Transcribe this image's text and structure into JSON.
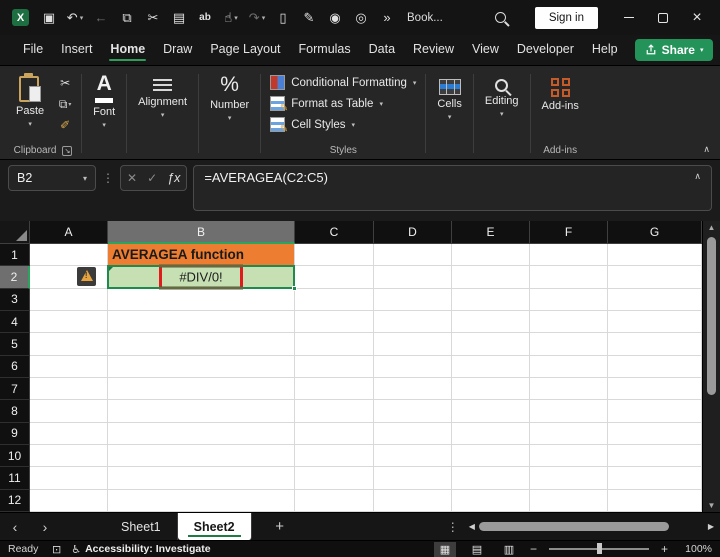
{
  "titlebar": {
    "workbook_title": "Book...",
    "signin_label": "Sign in",
    "qat": [
      {
        "name": "save-icon",
        "glyph": "▣"
      },
      {
        "name": "undo-icon",
        "glyph": "↶",
        "chevron": true
      },
      {
        "name": "back-icon",
        "glyph": "←",
        "dim": true
      },
      {
        "name": "copy-icon",
        "glyph": "⧉"
      },
      {
        "name": "cut-icon",
        "glyph": "✂"
      },
      {
        "name": "paste-icon",
        "glyph": "▤"
      },
      {
        "name": "find-replace-icon",
        "glyph": "ab",
        "text": true
      },
      {
        "name": "touch-mode-icon",
        "glyph": "☝",
        "chevron": true
      },
      {
        "name": "redo-icon",
        "glyph": "↷",
        "dim": true,
        "chevron": true
      },
      {
        "name": "new-file-icon",
        "glyph": "▯"
      },
      {
        "name": "ink-pen-icon",
        "glyph": "✎"
      },
      {
        "name": "camera-icon",
        "glyph": "◉"
      },
      {
        "name": "print-preview-icon",
        "glyph": "◎"
      },
      {
        "name": "more-commands-icon",
        "glyph": "»"
      }
    ]
  },
  "ribbon": {
    "tabs": [
      {
        "label": "File",
        "active": false
      },
      {
        "label": "Insert",
        "active": false
      },
      {
        "label": "Home",
        "active": true
      },
      {
        "label": "Draw",
        "active": false
      },
      {
        "label": "Page Layout",
        "active": false
      },
      {
        "label": "Formulas",
        "active": false
      },
      {
        "label": "Data",
        "active": false
      },
      {
        "label": "Review",
        "active": false
      },
      {
        "label": "View",
        "active": false
      },
      {
        "label": "Developer",
        "active": false
      },
      {
        "label": "Help",
        "active": false
      }
    ],
    "share_label": "Share",
    "clipboard": {
      "paste_label": "Paste",
      "group_label": "Clipboard"
    },
    "font": {
      "label": "Font"
    },
    "alignment": {
      "label": "Alignment"
    },
    "number": {
      "label": "Number"
    },
    "styles": {
      "group_label": "Styles",
      "items": [
        "Conditional Formatting",
        "Format as Table",
        "Cell Styles"
      ]
    },
    "cells": {
      "label": "Cells"
    },
    "editing": {
      "label": "Editing"
    },
    "addins": {
      "button_label": "Add-ins",
      "group_label": "Add-ins"
    }
  },
  "formula_bar": {
    "cell_reference": "B2",
    "formula": "=AVERAGEA(C2:C5)"
  },
  "grid": {
    "columns": [
      "A",
      "B",
      "C",
      "D",
      "E",
      "F",
      "G"
    ],
    "rows": [
      "1",
      "2",
      "3",
      "4",
      "5",
      "6",
      "7",
      "8",
      "9",
      "10",
      "11",
      "12"
    ],
    "selected_column": "B",
    "selected_row": "2",
    "cells": {
      "B1": {
        "text": "AVERAGEA function",
        "background": "#ED7D31"
      },
      "B2": {
        "text": "#DIV/0!",
        "background": "#C6E0B4",
        "highlight_border": "#E01B1B"
      }
    },
    "error_indicator_cell": "A2",
    "colors": {
      "accent_green": "#21A366",
      "selection_border": "#1E8A4E",
      "selected_header": "#6F6F6F",
      "header_bg": "#101010",
      "cell_bg": "#FFFFFF"
    }
  },
  "sheet_tabs": {
    "tabs": [
      {
        "label": "Sheet1",
        "active": false
      },
      {
        "label": "Sheet2",
        "active": true
      }
    ]
  },
  "status_bar": {
    "mode": "Ready",
    "accessibility": "Accessibility: Investigate",
    "zoom_level": "100%"
  }
}
